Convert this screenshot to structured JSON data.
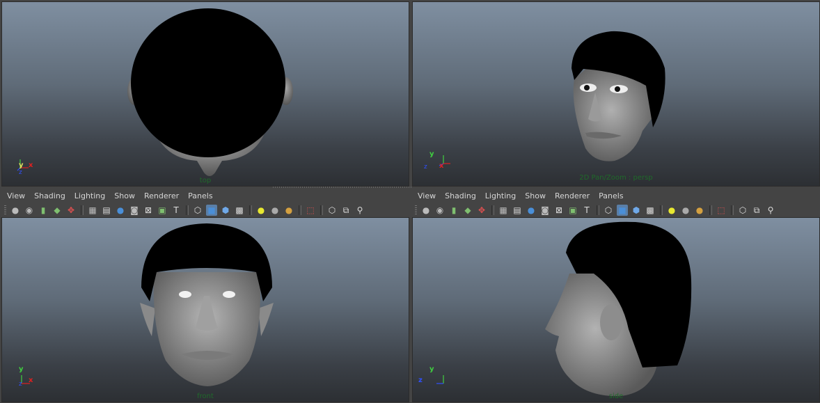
{
  "viewports": {
    "top": {
      "camera": "top"
    },
    "persp": {
      "camera": "2D Pan/Zoom : persp"
    },
    "front": {
      "camera": "front"
    },
    "side": {
      "camera": "side"
    }
  },
  "axes": {
    "x": "x",
    "y": "y",
    "z": "z"
  },
  "menus": [
    "View",
    "Shading",
    "Lighting",
    "Show",
    "Renderer",
    "Panels"
  ],
  "toolbar_icons": [
    "camera-attributes-icon",
    "camera-tools-icon",
    "bookmark-icon",
    "image-plane-icon",
    "2d-pan-zoom-icon",
    "grid-icon",
    "film-gate-icon",
    "resolution-gate-icon",
    "gate-mask-icon",
    "field-chart-icon",
    "safe-action-icon",
    "safe-title-icon",
    "wireframe-icon",
    "smooth-shade-icon",
    "default-material-icon",
    "textured-icon",
    "use-all-lights-icon",
    "shadows-icon",
    "high-quality-icon",
    "isolate-select-icon",
    "xray-icon",
    "xray-joints-icon",
    "xray-components-icon"
  ],
  "colors": {
    "viewport_top": "#7f8fa1",
    "viewport_bottom": "#2c2f33",
    "camera_label": "#1f6a2a",
    "axis_x": "#e02020",
    "axis_y": "#40d040",
    "axis_z": "#3050ff",
    "skin": "#8c8c8c",
    "hair": "#000000"
  }
}
